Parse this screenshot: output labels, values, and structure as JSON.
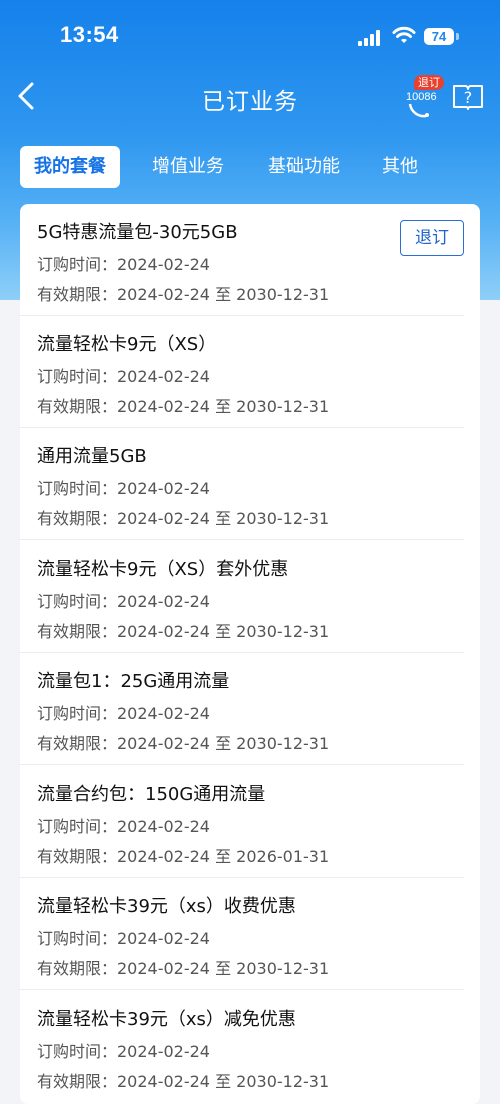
{
  "status_bar": {
    "time": "13:54",
    "battery": "74"
  },
  "header": {
    "title": "已订业务",
    "back_icon": "chevron-left-icon",
    "service_badge": "退订",
    "service_number": "10086",
    "help_icon": "help-book-icon"
  },
  "tabs": [
    {
      "label": "我的套餐",
      "active": true
    },
    {
      "label": "增值业务",
      "active": false
    },
    {
      "label": "基础功能",
      "active": false
    },
    {
      "label": "其他",
      "active": false
    }
  ],
  "packages": [
    {
      "name": "5G特惠流量包-30元5GB",
      "purchase": "订购时间：2024-02-24",
      "validity": "有效期限：2024-02-24 至 2030-12-31",
      "action": "退订"
    },
    {
      "name": "流量轻松卡9元（XS）",
      "purchase": "订购时间：2024-02-24",
      "validity": "有效期限：2024-02-24 至 2030-12-31"
    },
    {
      "name": "通用流量5GB",
      "purchase": "订购时间：2024-02-24",
      "validity": "有效期限：2024-02-24 至 2030-12-31"
    },
    {
      "name": "流量轻松卡9元（XS）套外优惠",
      "purchase": "订购时间：2024-02-24",
      "validity": "有效期限：2024-02-24 至 2030-12-31"
    },
    {
      "name": "流量包1：25G通用流量",
      "purchase": "订购时间：2024-02-24",
      "validity": "有效期限：2024-02-24 至 2030-12-31"
    },
    {
      "name": "流量合约包：150G通用流量",
      "purchase": "订购时间：2024-02-24",
      "validity": "有效期限：2024-02-24 至 2026-01-31"
    },
    {
      "name": "流量轻松卡39元（xs）收费优惠",
      "purchase": "订购时间：2024-02-24",
      "validity": "有效期限：2024-02-24 至 2030-12-31"
    },
    {
      "name": "流量轻松卡39元（xs）减免优惠",
      "purchase": "订购时间：2024-02-24",
      "validity": "有效期限：2024-02-24 至 2030-12-31"
    }
  ],
  "colors": {
    "header_blue": "#1581ea",
    "accent_blue": "#1673e6",
    "badge_red": "#e8412f"
  }
}
